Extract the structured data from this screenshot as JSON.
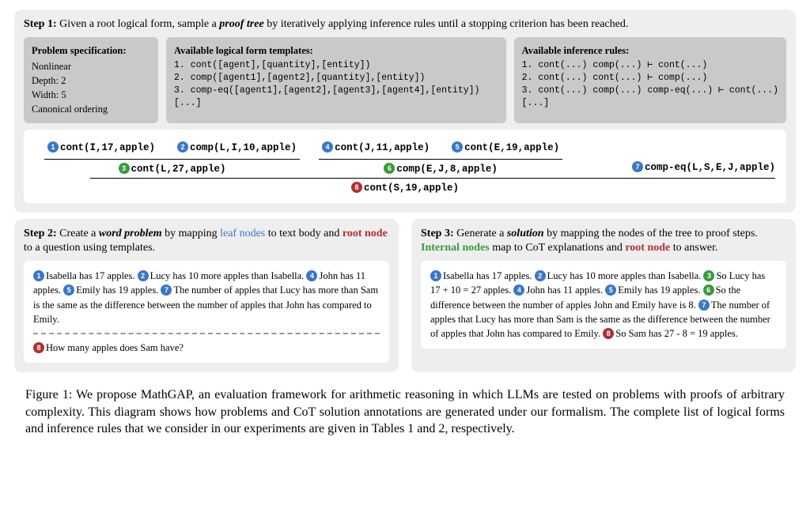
{
  "step1": {
    "label": "Step 1:",
    "desc": "Given a root logical form, sample a ",
    "desc_em": "proof tree",
    "desc_tail": " by iteratively applying inference rules until a stopping criterion has been reached.",
    "spec": {
      "title": "Problem specification:",
      "lines": [
        "Nonlinear",
        "Depth: 2",
        "Width: 5",
        "Canonical ordering"
      ]
    },
    "templates": {
      "title": "Available logical form templates:",
      "code": "1. cont([agent],[quantity],[entity])\n2. comp([agent1],[agent2],[quantity],[entity])\n3. comp-eq([agent1],[agent2],[agent3],[agent4],[entity])\n[...]"
    },
    "rules": {
      "title": "Available inference rules:",
      "code": "1. cont(...) comp(...) ⊢ cont(...)\n2. cont(...) cont(...) ⊢ comp(...)\n3. cont(...) comp(...) comp-eq(...) ⊢ cont(...)\n[...]"
    },
    "tree": {
      "n1": "cont(I,17,apple)",
      "n2": "comp(L,I,10,apple)",
      "n3": "cont(L,27,apple)",
      "n4": "cont(J,11,apple)",
      "n5": "cont(E,19,apple)",
      "n6": "comp(E,J,8,apple)",
      "n7": "comp-eq(L,S,E,J,apple)",
      "n8": "cont(S,19,apple)"
    }
  },
  "step2": {
    "label": "Step 2:",
    "desc_pre": "Create a ",
    "desc_em": "word problem",
    "desc_mid": " by mapping ",
    "leaf": "leaf nodes",
    "desc_mid2": " to text body and ",
    "root": "root node",
    "desc_tail": " to a question using templates.",
    "body": {
      "s1": "Isabella has 17 apples.",
      "s2": "Lucy has 10 more apples than Isabella.",
      "s4": "John has 11 apples.",
      "s5": "Emily has 19 apples.",
      "s7": "The number of apples that Lucy has more than Sam is the same as the difference between the number of apples that John has compared to Emily.",
      "q8": "How many apples does Sam have?"
    }
  },
  "step3": {
    "label": "Step 3:",
    "desc_pre": "Generate a ",
    "desc_em": "solution",
    "desc_mid": " by mapping the nodes of the tree to proof steps. ",
    "internal": "Internal nodes",
    "desc_mid2": " map to CoT explanations and ",
    "root": "root node",
    "desc_tail": " to answer.",
    "body": {
      "s1": "Isabella has 17 apples.",
      "s2": "Lucy has 10 more apples than Isabella.",
      "s3": "So Lucy has 17 + 10 = 27 apples.",
      "s4": "John has 11 apples.",
      "s5": "Emily has 19 apples.",
      "s6": "So the difference between the number of apples John and Emily have is 8.",
      "s7": "The number of apples that Lucy has more than Sam is the same as the difference between the number of apples that John has compared to Emily.",
      "s8": "So Sam has 27 - 8 = 19 apples."
    }
  },
  "caption": "Figure 1: We propose MathGAP, an evaluation framework for arithmetic reasoning in which LLMs are tested on problems with proofs of arbitrary complexity. This diagram shows how problems and CoT solution annotations are generated under our formalism. The complete list of logical forms and inference rules that we consider in our experiments are given in Tables 1 and 2, respectively."
}
